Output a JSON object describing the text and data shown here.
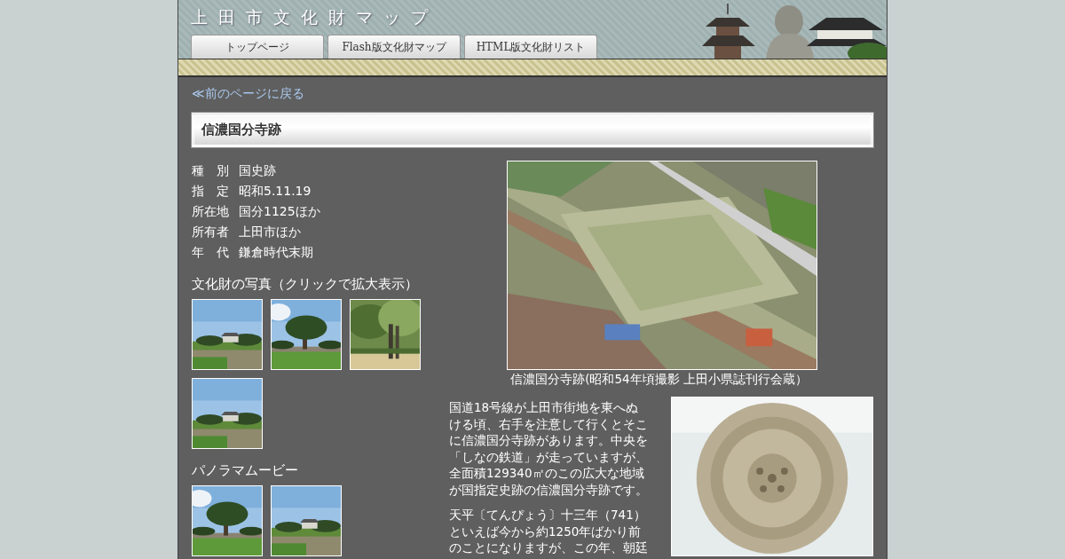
{
  "header": {
    "site_title": "上田市文化財マップ",
    "tabs": [
      {
        "label": "トップページ",
        "selected": false
      },
      {
        "label": "Flash版文化財マップ",
        "selected": false
      },
      {
        "label": "HTML版文化財リスト",
        "selected": false
      }
    ]
  },
  "back_link": "≪前のページに戻る",
  "heading": "信濃国分寺跡",
  "info": [
    {
      "label": "種　別",
      "value": "国史跡"
    },
    {
      "label": "指　定",
      "value": "昭和5.11.19"
    },
    {
      "label": "所在地",
      "value": "国分1125ほか"
    },
    {
      "label": "所有者",
      "value": "上田市ほか"
    },
    {
      "label": "年　代",
      "value": "鎌倉時代末期"
    }
  ],
  "photos": {
    "title": "文化財の写真（クリックで拡大表示）",
    "items": [
      {
        "kind": "field"
      },
      {
        "kind": "tree"
      },
      {
        "kind": "pine"
      },
      {
        "kind": "field"
      }
    ]
  },
  "movies": {
    "title": "パノラマムービー",
    "items": [
      {
        "kind": "tree"
      },
      {
        "kind": "field"
      }
    ]
  },
  "main_photo": {
    "caption": "信濃国分寺跡(昭和54年頃撮影 上田小県誌刊行会蔵）"
  },
  "paragraphs": [
    {
      "lines": [
        "国道18号線が上田市街地を東へぬ",
        "ける頃、右手を注意して行くとそこ",
        "に信濃国分寺跡があります。中央を",
        "「しなの鉄道」が走っていますが、",
        "全面積129340㎡のこの広大な地域",
        "が国指定史跡の信濃国分寺跡です。"
      ]
    },
    {
      "lines": [
        "天平〔てんぴょう〕十三年（741）",
        "といえば今から約1250年ばかり前",
        "のことになりますが、この年、朝廷"
      ]
    }
  ]
}
